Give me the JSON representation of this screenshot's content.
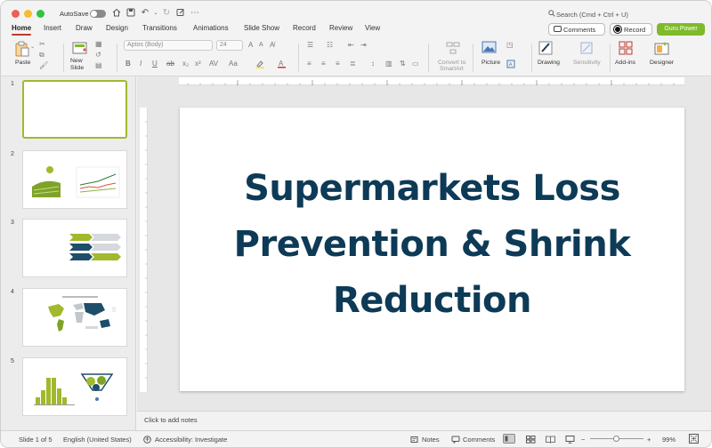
{
  "titlebar": {
    "autosave_label": "AutoSave",
    "search_placeholder": "Search (Cmd + Ctrl + U)"
  },
  "tabs": [
    "Home",
    "Insert",
    "Draw",
    "Design",
    "Transitions",
    "Animations",
    "Slide Show",
    "Record",
    "Review",
    "View"
  ],
  "active_tab": "Home",
  "header_buttons": {
    "comments": "Comments",
    "record": "Record",
    "guru": "Guru Power"
  },
  "ribbon": {
    "paste": "Paste",
    "new_slide_1": "New",
    "new_slide_2": "Slide",
    "font_name": "Aptos (Body)",
    "font_size": "24",
    "convert_1": "Convert to",
    "convert_2": "SmartArt",
    "picture": "Picture",
    "drawing": "Drawing",
    "sensitivity": "Sensitivity",
    "addins": "Add-ins",
    "designer": "Designer"
  },
  "thumbnails": [
    {
      "number": "1",
      "selected": true
    },
    {
      "number": "2",
      "selected": false
    },
    {
      "number": "3",
      "selected": false
    },
    {
      "number": "4",
      "selected": false
    },
    {
      "number": "5",
      "selected": false
    }
  ],
  "slide": {
    "title_line1": "Supermarkets Loss",
    "title_line2": "Prevention & Shrink",
    "title_line3": "Reduction"
  },
  "notes_placeholder": "Click to add notes",
  "status": {
    "slide_counter": "Slide 1 of 5",
    "language": "English (United States)",
    "accessibility": "Accessibility: Investigate",
    "notes": "Notes",
    "comments": "Comments",
    "zoom": "99%"
  },
  "colors": {
    "title_text": "#0d3a56",
    "accent_green": "#7fba2b",
    "thumb_selected": "#a2b82d",
    "tab_underline": "#c0392b"
  }
}
